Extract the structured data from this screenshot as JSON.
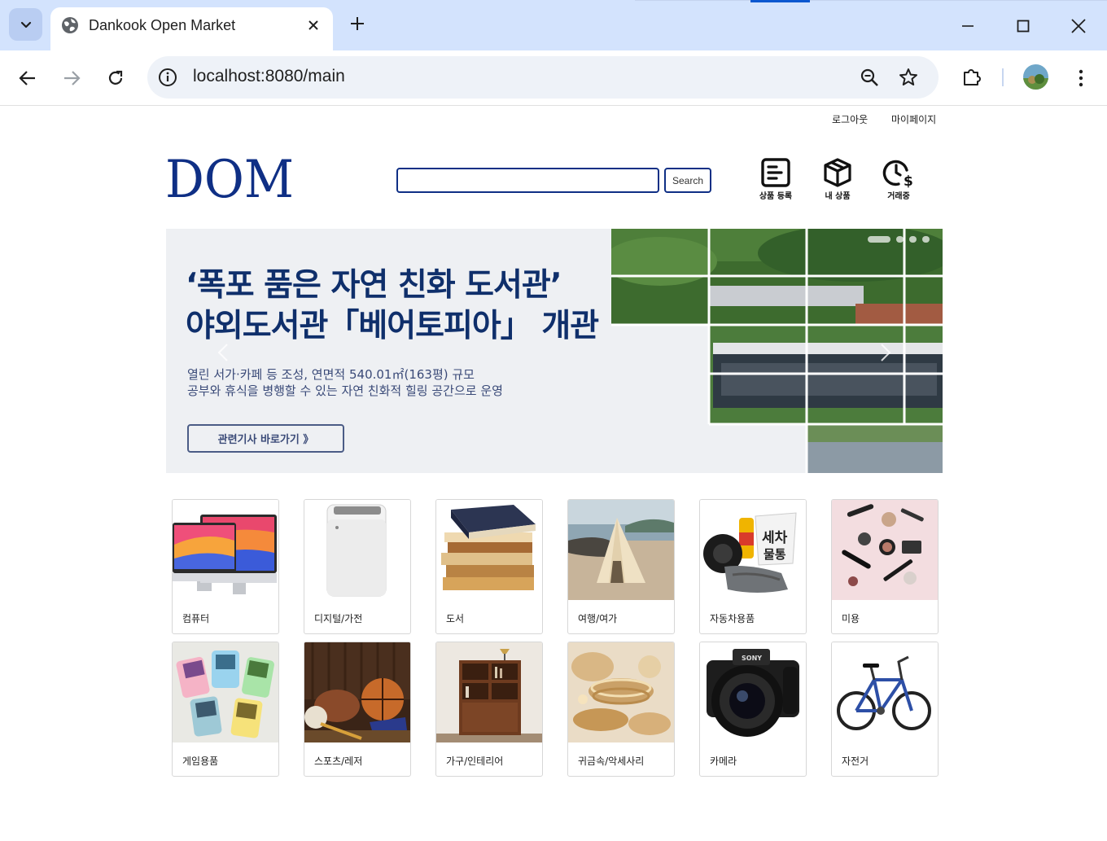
{
  "browser": {
    "tab_title": "Dankook Open Market",
    "url": "localhost:8080/main",
    "accent_color": "#0b57d0",
    "tabstrip_color": "#d3e3fd"
  },
  "header": {
    "logout_label": "로그아웃",
    "mypage_label": "마이페이지",
    "logo_text": "DOM",
    "brand_color": "#0f2f85",
    "search_placeholder": "",
    "search_button": "Search",
    "quick_links": [
      {
        "label": "상품 등록",
        "icon": "register-product-icon"
      },
      {
        "label": "내 상품",
        "icon": "box-icon"
      },
      {
        "label": "거래중",
        "icon": "clock-dollar-icon"
      }
    ]
  },
  "banner": {
    "title_line1": "‘폭포 품은 자연 친화 도서관’",
    "title_line2": "야외도서관「베어토피아」 개관",
    "sub_line1": "열린 서가·카페 등 조성, 연면적 540.01㎡(163평) 규모",
    "sub_line2": "공부와 휴식을 병행할 수 있는 자연 친화적 힐링 공간으로 운영",
    "cta_label": "관련기사 바로가기 》",
    "slide_count": 4,
    "active_slide": 1
  },
  "categories": [
    {
      "label": "컴퓨터",
      "image": "computer"
    },
    {
      "label": "디지털/가전",
      "image": "appliance"
    },
    {
      "label": "도서",
      "image": "books"
    },
    {
      "label": "여행/여가",
      "image": "travel"
    },
    {
      "label": "자동차용품",
      "image": "car"
    },
    {
      "label": "미용",
      "image": "beauty"
    },
    {
      "label": "게임용품",
      "image": "game"
    },
    {
      "label": "스포츠/레저",
      "image": "sports"
    },
    {
      "label": "가구/인테리어",
      "image": "furniture"
    },
    {
      "label": "귀금속/악세사리",
      "image": "jewelry"
    },
    {
      "label": "카메라",
      "image": "camera"
    },
    {
      "label": "자전거",
      "image": "bicycle"
    }
  ]
}
